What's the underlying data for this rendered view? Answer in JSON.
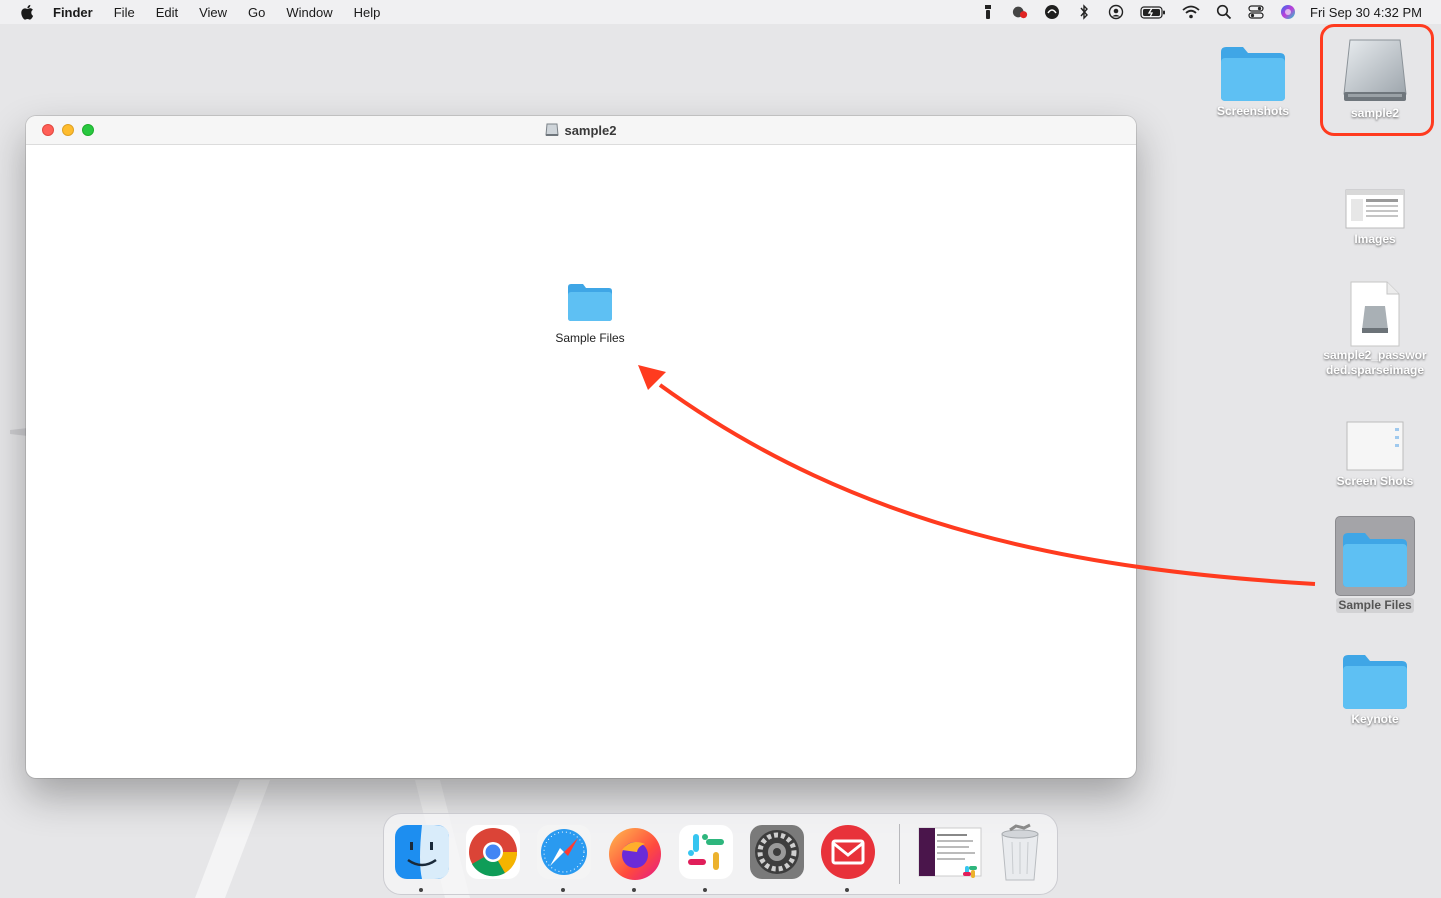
{
  "menubar": {
    "app_name": "Finder",
    "menus": [
      "File",
      "Edit",
      "View",
      "Go",
      "Window",
      "Help"
    ],
    "clock": "Fri Sep 30  4:32 PM"
  },
  "desktop": {
    "icons": [
      {
        "label": "Screenshots"
      },
      {
        "label": "sample2"
      },
      {
        "label": "Images"
      },
      {
        "label": "sample2_passwor\nded.sparseimage"
      },
      {
        "label": "Screen Shots"
      },
      {
        "label": "Sample Files"
      },
      {
        "label": "Keynote"
      }
    ]
  },
  "window": {
    "title": "sample2",
    "items": [
      {
        "label": "Sample Files"
      }
    ]
  },
  "dock": {
    "apps": [
      "finder-icon",
      "chrome-icon",
      "safari-icon",
      "firefox-icon",
      "slack-icon",
      "system-preferences-icon",
      "mail-icon",
      "window-thumbnail",
      "trash-icon"
    ]
  },
  "annotation": {
    "color": "#ff3b1f"
  }
}
